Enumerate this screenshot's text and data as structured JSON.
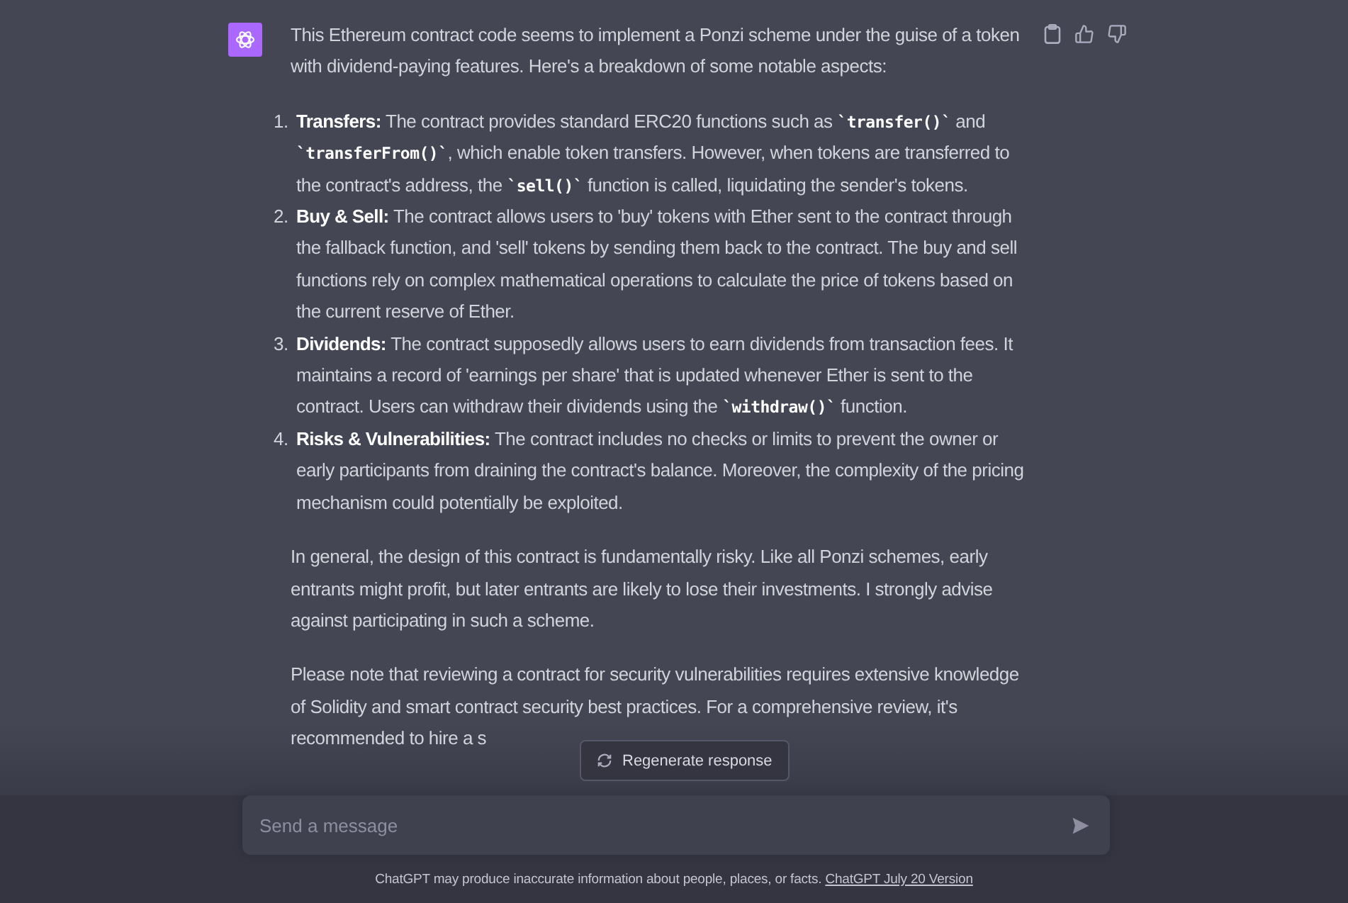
{
  "message": {
    "intro": "This Ethereum contract code seems to implement a Ponzi scheme under the guise of a token with dividend-paying features. Here's a breakdown of some notable aspects:",
    "actions": [
      {
        "kind": "copy"
      },
      {
        "kind": "like"
      },
      {
        "kind": "dislike"
      }
    ],
    "items": [
      {
        "number": "1.",
        "title": "Transfers:",
        "segments": [
          {
            "kind": "text",
            "text": " The contract provides standard ERC20 functions such as "
          },
          {
            "kind": "code",
            "text": "`transfer()`"
          },
          {
            "kind": "text",
            "text": " and "
          },
          {
            "kind": "code",
            "text": "`transferFrom()`"
          },
          {
            "kind": "text",
            "text": ", which enable token transfers. However, when tokens are transferred to the contract's address, the "
          },
          {
            "kind": "code",
            "text": "`sell()`"
          },
          {
            "kind": "text",
            "text": " function is called, liquidating the sender's tokens."
          }
        ]
      },
      {
        "number": "2.",
        "title": "Buy & Sell:",
        "segments": [
          {
            "kind": "text",
            "text": " The contract allows users to 'buy' tokens with Ether sent to the contract through the fallback function, and 'sell' tokens by sending them back to the contract. The buy and sell functions rely on complex mathematical operations to calculate the price of tokens based on the current reserve of Ether."
          }
        ]
      },
      {
        "number": "3.",
        "title": "Dividends:",
        "segments": [
          {
            "kind": "text",
            "text": " The contract supposedly allows users to earn dividends from transaction fees. It maintains a record of 'earnings per share' that is updated whenever Ether is sent to the contract. Users can withdraw their dividends using the "
          },
          {
            "kind": "code",
            "text": "`withdraw()`"
          },
          {
            "kind": "text",
            "text": " function."
          }
        ]
      },
      {
        "number": "4.",
        "title": "Risks & Vulnerabilities:",
        "segments": [
          {
            "kind": "text",
            "text": " The contract includes no checks or limits to prevent the owner or early participants from draining the contract's balance. Moreover, the complexity of the pricing mechanism could potentially be exploited."
          }
        ]
      }
    ],
    "paragraphs": [
      "In general, the design of this contract is fundamentally risky. Like all Ponzi schemes, early entrants might profit, but later entrants are likely to lose their investments. I strongly advise against participating in such a scheme.",
      "Please note that reviewing a contract for security vulnerabilities requires extensive knowledge of Solidity and smart contract security best practices. For a comprehensive review, it's recommended to hire a s"
    ]
  },
  "regenerate_button": {
    "label": "Regenerate response"
  },
  "composer": {
    "placeholder": "Send a message"
  },
  "footer": {
    "text": "ChatGPT may produce inaccurate information about people, places, or facts.",
    "link": "ChatGPT July 20 Version"
  }
}
